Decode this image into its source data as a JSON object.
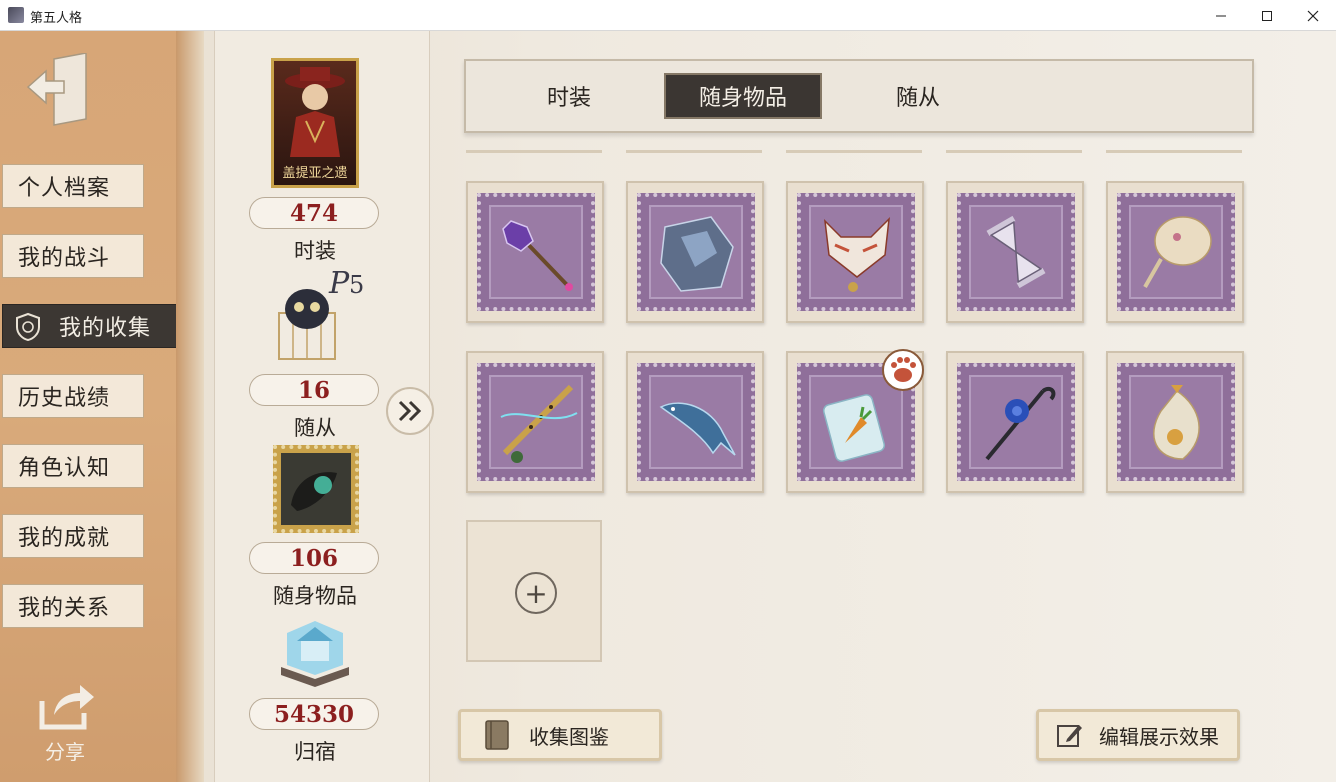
{
  "window": {
    "title": "第五人格",
    "minimize_icon": "minimize-icon",
    "maximize_icon": "maximize-icon",
    "close_icon": "close-icon"
  },
  "left_nav": {
    "back_icon": "back-door-icon",
    "items": [
      {
        "label": "个人档案",
        "active": false
      },
      {
        "label": "我的战斗",
        "active": false
      },
      {
        "label": "我的收集",
        "active": true
      },
      {
        "label": "历史战绩",
        "active": false
      },
      {
        "label": "角色认知",
        "active": false
      },
      {
        "label": "我的成就",
        "active": false
      },
      {
        "label": "我的关系",
        "active": false
      }
    ],
    "share_label": "分享",
    "share_icon": "share-icon"
  },
  "stats": [
    {
      "label": "时装",
      "value": "474",
      "card_caption": "盖提亚之遗"
    },
    {
      "label": "随从",
      "value": "16"
    },
    {
      "label": "随身物品",
      "value": "106"
    },
    {
      "label": "归宿",
      "value": "54330"
    }
  ],
  "tabs": [
    {
      "label": "时装",
      "active": false
    },
    {
      "label": "随身物品",
      "active": true
    },
    {
      "label": "随从",
      "active": false
    }
  ],
  "items": [
    {
      "icon": "crystal-mace-icon",
      "accent": "#7a4fb0"
    },
    {
      "icon": "crystal-gauntlet-icon",
      "accent": "#5e6e8a"
    },
    {
      "icon": "fox-mask-icon",
      "accent": "#c4533a"
    },
    {
      "icon": "hourglass-icon",
      "accent": "#9a8fb0"
    },
    {
      "icon": "feather-fan-icon",
      "accent": "#d8c6a0"
    },
    {
      "icon": "flute-icon",
      "accent": "#6f7f3a"
    },
    {
      "icon": "whale-icon",
      "accent": "#3f6f9a"
    },
    {
      "icon": "carrot-jar-icon",
      "accent": "#e08a2a"
    },
    {
      "icon": "blue-rose-cane-icon",
      "accent": "#2a4fb8"
    },
    {
      "icon": "lantern-icon",
      "accent": "#d8a040"
    }
  ],
  "empty_slot_icon": "plus-icon",
  "buttons": {
    "collection_label": "收集图鉴",
    "collection_icon": "book-icon",
    "edit_label": "编辑展示效果",
    "edit_icon": "edit-icon"
  }
}
